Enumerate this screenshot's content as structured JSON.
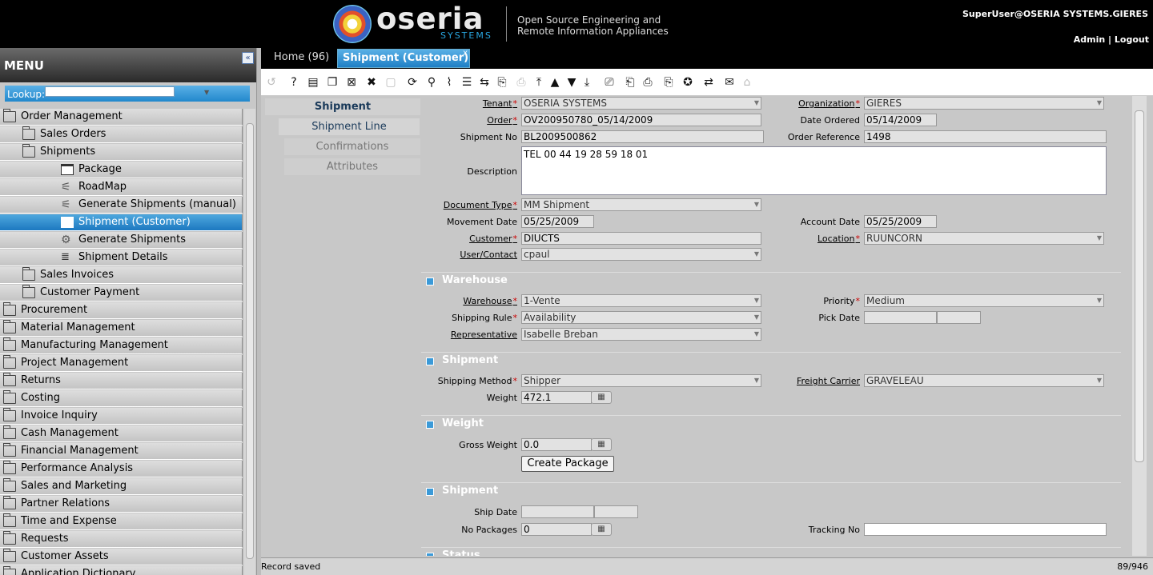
{
  "header": {
    "brand_name": "oseria",
    "brand_sub": "SYSTEMS",
    "tagline": "Open Source Engineering and\nRemote Information Appliances",
    "user": "SuperUser@OSERIA SYSTEMS.GIERES",
    "admin_link": "Admin",
    "separator": "|",
    "logout_link": "Logout"
  },
  "menu": {
    "title": "MENU",
    "collapse_icon": "«",
    "lookup_label": "Lookup:",
    "items": [
      {
        "label": "Order Management",
        "icon": "folder-open-icon",
        "level": 0
      },
      {
        "label": "Sales Orders",
        "icon": "folder-icon",
        "level": 1
      },
      {
        "label": "Shipments",
        "icon": "folder-open-icon",
        "level": 1
      },
      {
        "label": "Package",
        "icon": "window-icon",
        "level": 3
      },
      {
        "label": "RoadMap",
        "icon": "process-icon",
        "level": 3
      },
      {
        "label": "Generate Shipments (manual)",
        "icon": "process-icon",
        "level": 3
      },
      {
        "label": "Shipment (Customer)",
        "icon": "window-icon",
        "level": 3,
        "selected": true
      },
      {
        "label": "Generate Shipments",
        "icon": "gear-icon",
        "level": 3
      },
      {
        "label": "Shipment Details",
        "icon": "report-icon",
        "level": 3
      },
      {
        "label": "Sales Invoices",
        "icon": "folder-icon",
        "level": 1
      },
      {
        "label": "Customer Payment",
        "icon": "folder-icon",
        "level": 1
      },
      {
        "label": "Procurement",
        "icon": "folder-icon",
        "level": 0
      },
      {
        "label": "Material Management",
        "icon": "folder-icon",
        "level": 0
      },
      {
        "label": "Manufacturing Management",
        "icon": "folder-icon",
        "level": 0
      },
      {
        "label": "Project Management",
        "icon": "folder-icon",
        "level": 0
      },
      {
        "label": "Returns",
        "icon": "folder-icon",
        "level": 0
      },
      {
        "label": "Costing",
        "icon": "folder-icon",
        "level": 0
      },
      {
        "label": "Invoice Inquiry",
        "icon": "folder-icon",
        "level": 0
      },
      {
        "label": "Cash Management",
        "icon": "folder-icon",
        "level": 0
      },
      {
        "label": "Financial Management",
        "icon": "folder-icon",
        "level": 0
      },
      {
        "label": "Performance Analysis",
        "icon": "folder-icon",
        "level": 0
      },
      {
        "label": "Sales and Marketing",
        "icon": "folder-icon",
        "level": 0
      },
      {
        "label": "Partner Relations",
        "icon": "folder-icon",
        "level": 0
      },
      {
        "label": "Time and Expense",
        "icon": "folder-icon",
        "level": 0
      },
      {
        "label": "Requests",
        "icon": "folder-icon",
        "level": 0
      },
      {
        "label": "Customer Assets",
        "icon": "folder-icon",
        "level": 0
      },
      {
        "label": "Application Dictionary",
        "icon": "folder-icon",
        "level": 0
      }
    ]
  },
  "tabs": {
    "home": "Home (96)",
    "active": "Shipment (Customer)",
    "close": "x"
  },
  "toolbar": {
    "icons": [
      "undo-icon",
      "help-icon",
      "new-record-icon",
      "copy-record-icon",
      "delete-icon",
      "delete-selection-icon",
      "save-icon",
      "refresh-icon",
      "find-icon",
      "attachment-icon",
      "grid-toggle-icon",
      "history-icon",
      "zoom-across-icon",
      "active-workflows-icon",
      "first-record-icon",
      "previous-record-icon",
      "next-record-icon",
      "last-record-icon",
      "report-icon",
      "archive-icon",
      "print-icon",
      "print-preview-icon",
      "product-info-icon",
      "translation-icon",
      "request-icon",
      "go-home-icon"
    ]
  },
  "left_tabs": {
    "shipment": "Shipment",
    "shipment_line": "Shipment Line",
    "confirmations": "Confirmations",
    "attributes": "Attributes"
  },
  "form": {
    "tenant_label": "Tenant",
    "tenant": "OSERIA SYSTEMS",
    "organization_label": "Organization",
    "organization": "GIERES",
    "order_label": "Order",
    "order": "OV200950780_05/14/2009",
    "date_ordered_label": "Date Ordered",
    "date_ordered": "05/14/2009",
    "shipment_no_label": "Shipment No",
    "shipment_no": "BL2009500862",
    "order_reference_label": "Order Reference",
    "order_reference": "1498",
    "description_label": "Description",
    "description": "TEL 00 44 19 28 59 18 01",
    "document_type_label": "Document Type",
    "document_type": "MM Shipment",
    "movement_date_label": "Movement Date",
    "movement_date": "05/25/2009",
    "account_date_label": "Account Date",
    "account_date": "05/25/2009",
    "customer_label": "Customer",
    "customer": "DIUCTS",
    "location_label": "Location",
    "location": "RUUNCORN",
    "user_contact_label": "User/Contact",
    "user_contact": "cpaul",
    "sec_warehouse": "Warehouse",
    "warehouse_label": "Warehouse",
    "warehouse": "1-Vente",
    "priority_label": "Priority",
    "priority": "Medium",
    "shipping_rule_label": "Shipping Rule",
    "shipping_rule": "Availability",
    "pick_date_label": "Pick Date",
    "pick_date": "",
    "representative_label": "Representative",
    "representative": "Isabelle Breban",
    "sec_shipment": "Shipment",
    "shipping_method_label": "Shipping Method",
    "shipping_method": "Shipper",
    "freight_carrier_label": "Freight Carrier",
    "freight_carrier": "GRAVELEAU",
    "weight_label": "Weight",
    "weight": "472.1",
    "sec_weight": "Weight",
    "gross_weight_label": "Gross Weight",
    "gross_weight": "0.0",
    "create_package": "Create Package",
    "sec_shipment2": "Shipment",
    "ship_date_label": "Ship Date",
    "ship_date": "",
    "no_packages_label": "No Packages",
    "no_packages": "0",
    "tracking_no_label": "Tracking No",
    "tracking_no": "",
    "sec_status": "Status"
  },
  "status": {
    "message": "Record saved",
    "count": "89/946"
  },
  "colors": {
    "accent": "#2288cc",
    "header_bg": "#000000",
    "form_bg": "#c8c8c8",
    "required": "#cc0000"
  }
}
